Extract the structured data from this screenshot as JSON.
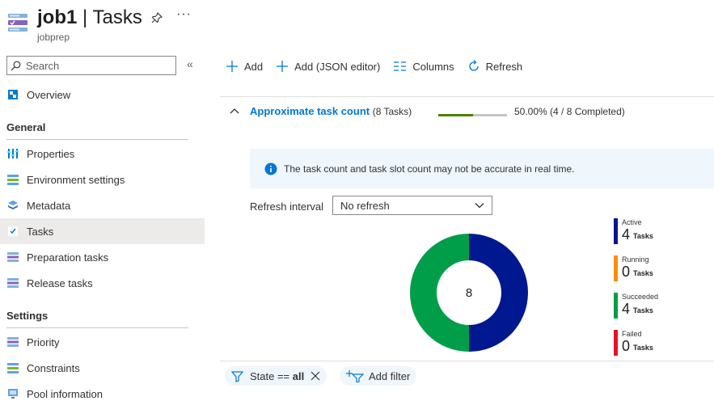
{
  "header": {
    "title_name": "job1",
    "title_sep": " | ",
    "title_page": "Tasks",
    "subtitle": "jobprep",
    "more_glyph": "···"
  },
  "sidebar": {
    "search_placeholder": "Search",
    "collapse_glyph": "«",
    "overview_label": "Overview",
    "sections": [
      {
        "title": "General",
        "items": [
          {
            "label": "Properties",
            "icon": "properties-icon"
          },
          {
            "label": "Environment settings",
            "icon": "environment-settings-icon"
          },
          {
            "label": "Metadata",
            "icon": "metadata-icon"
          },
          {
            "label": "Tasks",
            "icon": "tasks-icon",
            "selected": true
          },
          {
            "label": "Preparation tasks",
            "icon": "preparation-tasks-icon"
          },
          {
            "label": "Release tasks",
            "icon": "release-tasks-icon"
          }
        ]
      },
      {
        "title": "Settings",
        "items": [
          {
            "label": "Priority",
            "icon": "priority-icon"
          },
          {
            "label": "Constraints",
            "icon": "constraints-icon"
          },
          {
            "label": "Pool information",
            "icon": "pool-information-icon"
          }
        ]
      }
    ]
  },
  "toolbar": {
    "add_label": "Add",
    "add_json_label": "Add (JSON editor)",
    "columns_label": "Columns",
    "refresh_label": "Refresh"
  },
  "task_count": {
    "title": "Approximate task count",
    "subtitle": "(8 Tasks)",
    "progress_text": "50.00% (4 / 8 Completed)",
    "progress_fraction": 0.5
  },
  "info_bar": {
    "message": "The task count and task slot count may not be accurate in real time."
  },
  "refresh_interval": {
    "label": "Refresh interval",
    "value": "No refresh"
  },
  "chart_data": {
    "type": "pie",
    "center_label": "8",
    "categories": [
      "Active",
      "Running",
      "Succeeded",
      "Failed"
    ],
    "values": [
      4,
      0,
      4,
      0
    ],
    "unit": "Tasks",
    "colors": [
      "#00188f",
      "#ff8c00",
      "#009e49",
      "#e81123"
    ]
  },
  "filters": {
    "state_prefix": "State == ",
    "state_value": "all",
    "add_filter_label": "Add filter"
  },
  "colors": {
    "accent": "#0078d4",
    "progress": "#498205"
  }
}
